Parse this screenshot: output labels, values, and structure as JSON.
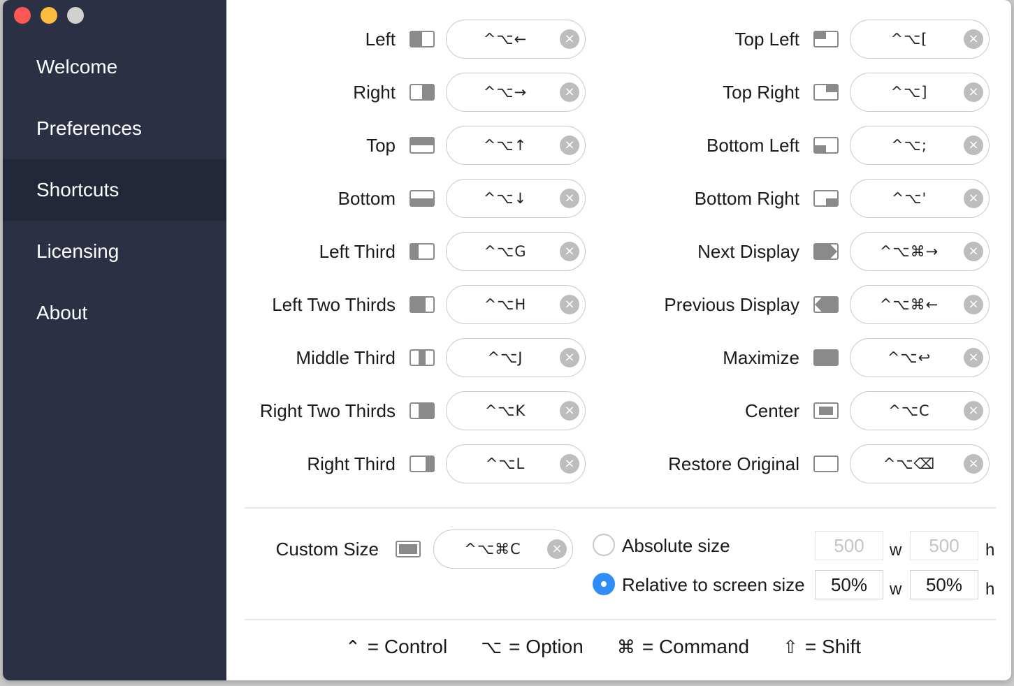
{
  "sidebar": {
    "items": [
      {
        "label": "Welcome"
      },
      {
        "label": "Preferences"
      },
      {
        "label": "Shortcuts"
      },
      {
        "label": "Licensing"
      },
      {
        "label": "About"
      }
    ],
    "active": "Shortcuts"
  },
  "shortcuts_left": [
    {
      "label": "Left",
      "keys": "^⌥←"
    },
    {
      "label": "Right",
      "keys": "^⌥→"
    },
    {
      "label": "Top",
      "keys": "^⌥↑"
    },
    {
      "label": "Bottom",
      "keys": "^⌥↓"
    },
    {
      "label": "Left Third",
      "keys": "^⌥G"
    },
    {
      "label": "Left Two Thirds",
      "keys": "^⌥H"
    },
    {
      "label": "Middle Third",
      "keys": "^⌥J"
    },
    {
      "label": "Right Two Thirds",
      "keys": "^⌥K"
    },
    {
      "label": "Right Third",
      "keys": "^⌥L"
    }
  ],
  "shortcuts_right": [
    {
      "label": "Top Left",
      "keys": "^⌥["
    },
    {
      "label": "Top Right",
      "keys": "^⌥]"
    },
    {
      "label": "Bottom Left",
      "keys": "^⌥;"
    },
    {
      "label": "Bottom Right",
      "keys": "^⌥'"
    },
    {
      "label": "Next Display",
      "keys": "^⌥⌘→"
    },
    {
      "label": "Previous Display",
      "keys": "^⌥⌘←"
    },
    {
      "label": "Maximize",
      "keys": "^⌥↩"
    },
    {
      "label": "Center",
      "keys": "^⌥C"
    },
    {
      "label": "Restore Original",
      "keys": "^⌥⌫"
    }
  ],
  "custom_size": {
    "label": "Custom Size",
    "keys": "^⌥⌘C",
    "absolute": {
      "label": "Absolute size",
      "width": "500",
      "height": "500",
      "selected": false
    },
    "relative": {
      "label": "Relative to screen size",
      "width": "50%",
      "height": "50%",
      "selected": true
    },
    "w_unit": "w",
    "h_unit": "h"
  },
  "legend": {
    "control": {
      "symbol": "⌃",
      "text": "= Control"
    },
    "option": {
      "symbol": "⌥",
      "text": "= Option"
    },
    "command": {
      "symbol": "⌘",
      "text": "= Command"
    },
    "shift": {
      "symbol": "⇧",
      "text": "= Shift"
    }
  },
  "clear_glyph": "×",
  "colors": {
    "sidebar": "#2c3045",
    "sidebar_active": "#23273a",
    "accent": "#2f8ef5",
    "icon_gray": "#8a8a8a"
  }
}
